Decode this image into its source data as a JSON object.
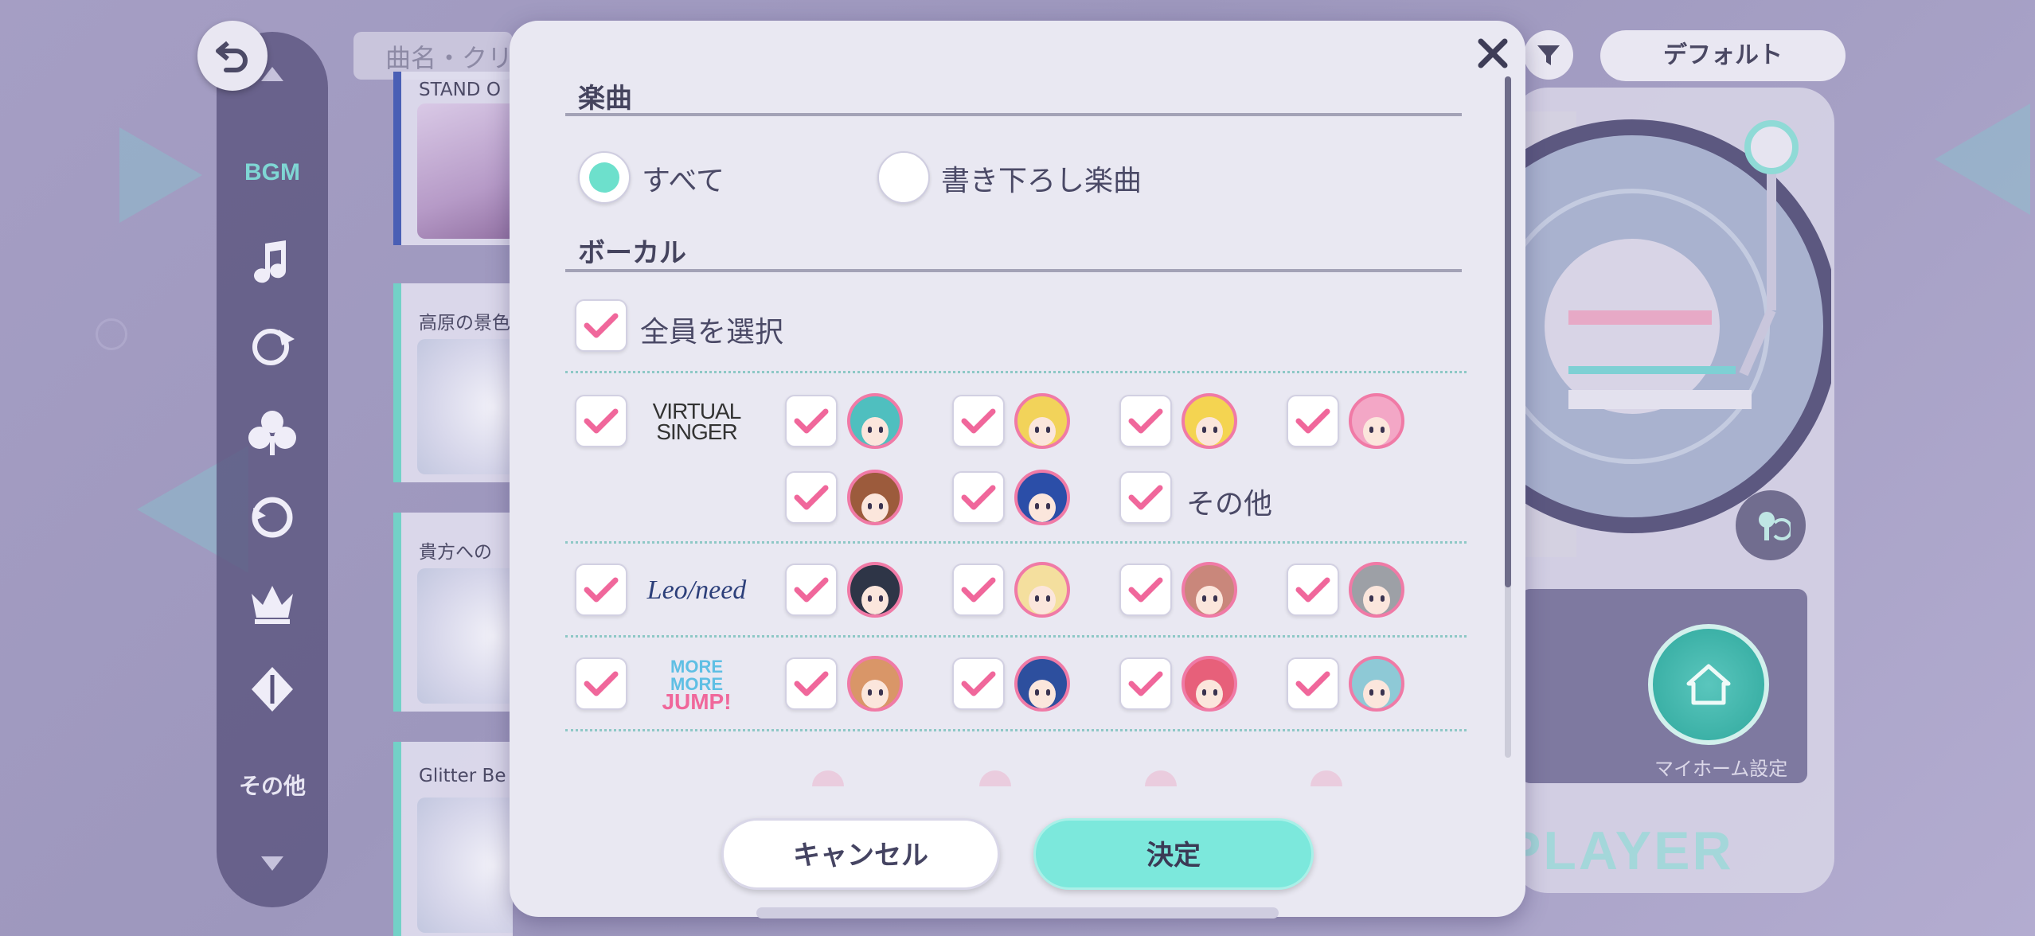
{
  "background": {
    "search_placeholder": "曲名・クリ",
    "sidebar": {
      "items": [
        {
          "label": "BGM",
          "icon": "bgm-label"
        },
        {
          "icon": "music-note-icon"
        },
        {
          "icon": "leo-need-icon"
        },
        {
          "icon": "clover-icon"
        },
        {
          "icon": "vivid-bad-squad-icon"
        },
        {
          "icon": "crown-icon"
        },
        {
          "icon": "nightcord-icon"
        },
        {
          "label": "その他",
          "icon": "other-label"
        }
      ]
    },
    "songs": [
      {
        "title": "STAND O"
      },
      {
        "title": "高原の景色"
      },
      {
        "title": "貴方への"
      },
      {
        "title": "Glitter Be"
      }
    ],
    "default_button": "デフォルト",
    "home_settings_label": "マイホーム設定",
    "player_label": "PLAYER"
  },
  "modal": {
    "section_song": {
      "title": "楽曲",
      "options": [
        {
          "label": "すべて",
          "selected": true
        },
        {
          "label": "書き下ろし楽曲",
          "selected": false
        }
      ]
    },
    "section_vocal": {
      "title": "ボーカル",
      "select_all": {
        "label": "全員を選択",
        "checked": true
      },
      "groups": [
        {
          "unit": "VIRTUAL SINGER",
          "logo_lines": [
            "VIRTUAL",
            "SINGER"
          ],
          "checked": true,
          "members": [
            {
              "name": "miku",
              "hair": "#4fbfbf",
              "checked": true
            },
            {
              "name": "rin",
              "hair": "#f2d35a",
              "checked": true
            },
            {
              "name": "len",
              "hair": "#f4d451",
              "checked": true
            },
            {
              "name": "luka",
              "hair": "#f3a7c6",
              "checked": true
            },
            {
              "name": "meiko",
              "hair": "#9c5b3c",
              "checked": true
            },
            {
              "name": "kaito",
              "hair": "#2b4ea8",
              "checked": true
            }
          ],
          "other": {
            "label": "その他",
            "checked": true
          }
        },
        {
          "unit": "Leo/need",
          "logo_text": "Leo/need",
          "checked": true,
          "members": [
            {
              "name": "ichika",
              "hair": "#2e3547",
              "checked": true
            },
            {
              "name": "saki",
              "hair": "#f4df9e",
              "checked": true
            },
            {
              "name": "honami",
              "hair": "#c9877b",
              "checked": true
            },
            {
              "name": "shiho",
              "hair": "#9da0a6",
              "checked": true
            }
          ]
        },
        {
          "unit": "MORE MORE JUMP!",
          "logo_lines": [
            "MORE MORE",
            "JUMP!"
          ],
          "checked": true,
          "members": [
            {
              "name": "minori",
              "hair": "#d99668",
              "checked": true
            },
            {
              "name": "haruka",
              "hair": "#2d4f9e",
              "checked": true
            },
            {
              "name": "airi",
              "hair": "#e7607a",
              "checked": true
            },
            {
              "name": "shizuku",
              "hair": "#8ec9d6",
              "checked": true
            }
          ]
        }
      ]
    },
    "buttons": {
      "cancel": "キャンセル",
      "ok": "決定"
    }
  },
  "colors": {
    "accent_teal": "#6de0cc",
    "check_pink": "#f0679b",
    "avatar_ring": "#f07aa6",
    "modal_bg": "#e9e8f2",
    "text_dark": "#45445e"
  }
}
